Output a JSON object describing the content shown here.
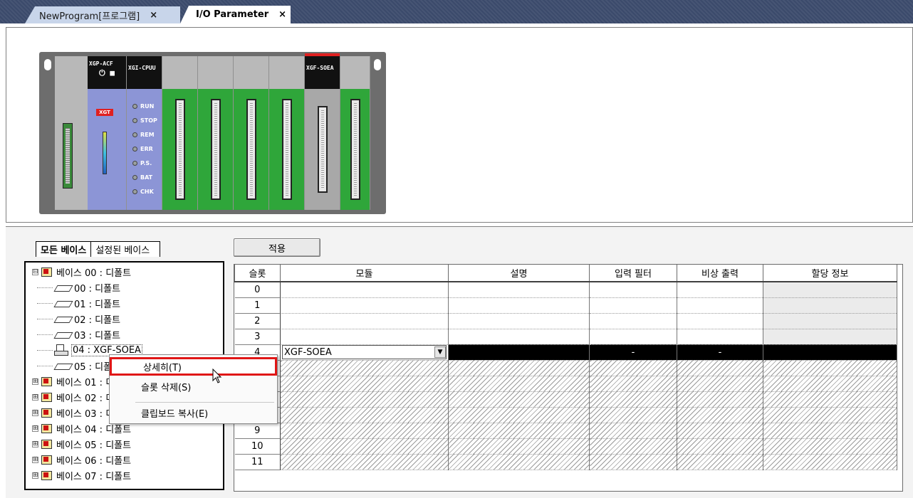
{
  "tabs": [
    {
      "label": "NewProgram[프로그램]",
      "close": "×",
      "active": false
    },
    {
      "label": "I/O Parameter",
      "close": "×",
      "active": true
    }
  ],
  "rack": {
    "power_module_label": "XGP-ACF",
    "power_symbols": "⏻ ■",
    "power_brand": "XGT",
    "cpu_module_label": "XGI-CPUU",
    "cpu_leds": [
      "RUN",
      "STOP",
      "REM",
      "ERR",
      "P.S.",
      "BAT",
      "CHK"
    ],
    "soe_module_label": "XGF-SOEA",
    "slot_count": 6,
    "colors": {
      "io_module": "#2fa63a",
      "cpu_module": "#8c95d6",
      "rack_base": "#6d6d6d"
    }
  },
  "base_tabs": [
    {
      "label": "모든 베이스",
      "selected": true
    },
    {
      "label": "설정된 베이스",
      "selected": false
    }
  ],
  "apply_button": "적용",
  "tree": {
    "root": {
      "expander": "⊟",
      "label": "베이스 00 : 디폴트"
    },
    "slots": [
      {
        "label": "00 : 디폴트",
        "icon": "slot-icon"
      },
      {
        "label": "01 : 디폴트",
        "icon": "slot-icon"
      },
      {
        "label": "02 : 디폴트",
        "icon": "slot-icon"
      },
      {
        "label": "03 : 디폴트",
        "icon": "slot-icon"
      },
      {
        "label": "04 : XGF-SOEA",
        "icon": "module-icon"
      },
      {
        "label": "05 : 디폴트",
        "icon": "slot-icon"
      }
    ],
    "bases": [
      {
        "expander": "⊞",
        "label": "베이스 01 : 디폴트"
      },
      {
        "expander": "⊞",
        "label": "베이스 02 : 디폴트"
      },
      {
        "expander": "⊞",
        "label": "베이스 03 : 디폴트"
      },
      {
        "expander": "⊞",
        "label": "베이스 04 : 디폴트"
      },
      {
        "expander": "⊞",
        "label": "베이스 05 : 디폴트"
      },
      {
        "expander": "⊞",
        "label": "베이스 06 : 디폴트"
      },
      {
        "expander": "⊞",
        "label": "베이스 07 : 디폴트"
      }
    ]
  },
  "grid": {
    "columns": [
      "슬롯",
      "모듈",
      "설명",
      "입력 필터",
      "비상 출력",
      "할당 정보"
    ],
    "rows": [
      {
        "slot": "0",
        "module": "",
        "filter": "",
        "emergency": ""
      },
      {
        "slot": "1",
        "module": "",
        "filter": "",
        "emergency": ""
      },
      {
        "slot": "2",
        "module": "",
        "filter": "",
        "emergency": ""
      },
      {
        "slot": "3",
        "module": "",
        "filter": "",
        "emergency": ""
      },
      {
        "slot": "4",
        "module": "XGF-SOEA",
        "filter": "-",
        "emergency": "-"
      },
      {
        "slot": "",
        "module": "",
        "filter": "",
        "emergency": ""
      },
      {
        "slot": "",
        "module": "",
        "filter": "",
        "emergency": ""
      },
      {
        "slot": "",
        "module": "",
        "filter": "",
        "emergency": ""
      },
      {
        "slot": "",
        "module": "",
        "filter": "",
        "emergency": ""
      },
      {
        "slot": "9",
        "module": "",
        "filter": "",
        "emergency": ""
      },
      {
        "slot": "10",
        "module": "",
        "filter": "",
        "emergency": ""
      },
      {
        "slot": "11",
        "module": "",
        "filter": "",
        "emergency": ""
      }
    ],
    "dropdown_arrow": "▼"
  },
  "context_menu": {
    "items": [
      "상세히(T)",
      "슬롯 삭제(S)",
      "클립보드 복사(E)"
    ],
    "highlighted_index": 0,
    "highlight_color": "#e01616"
  }
}
